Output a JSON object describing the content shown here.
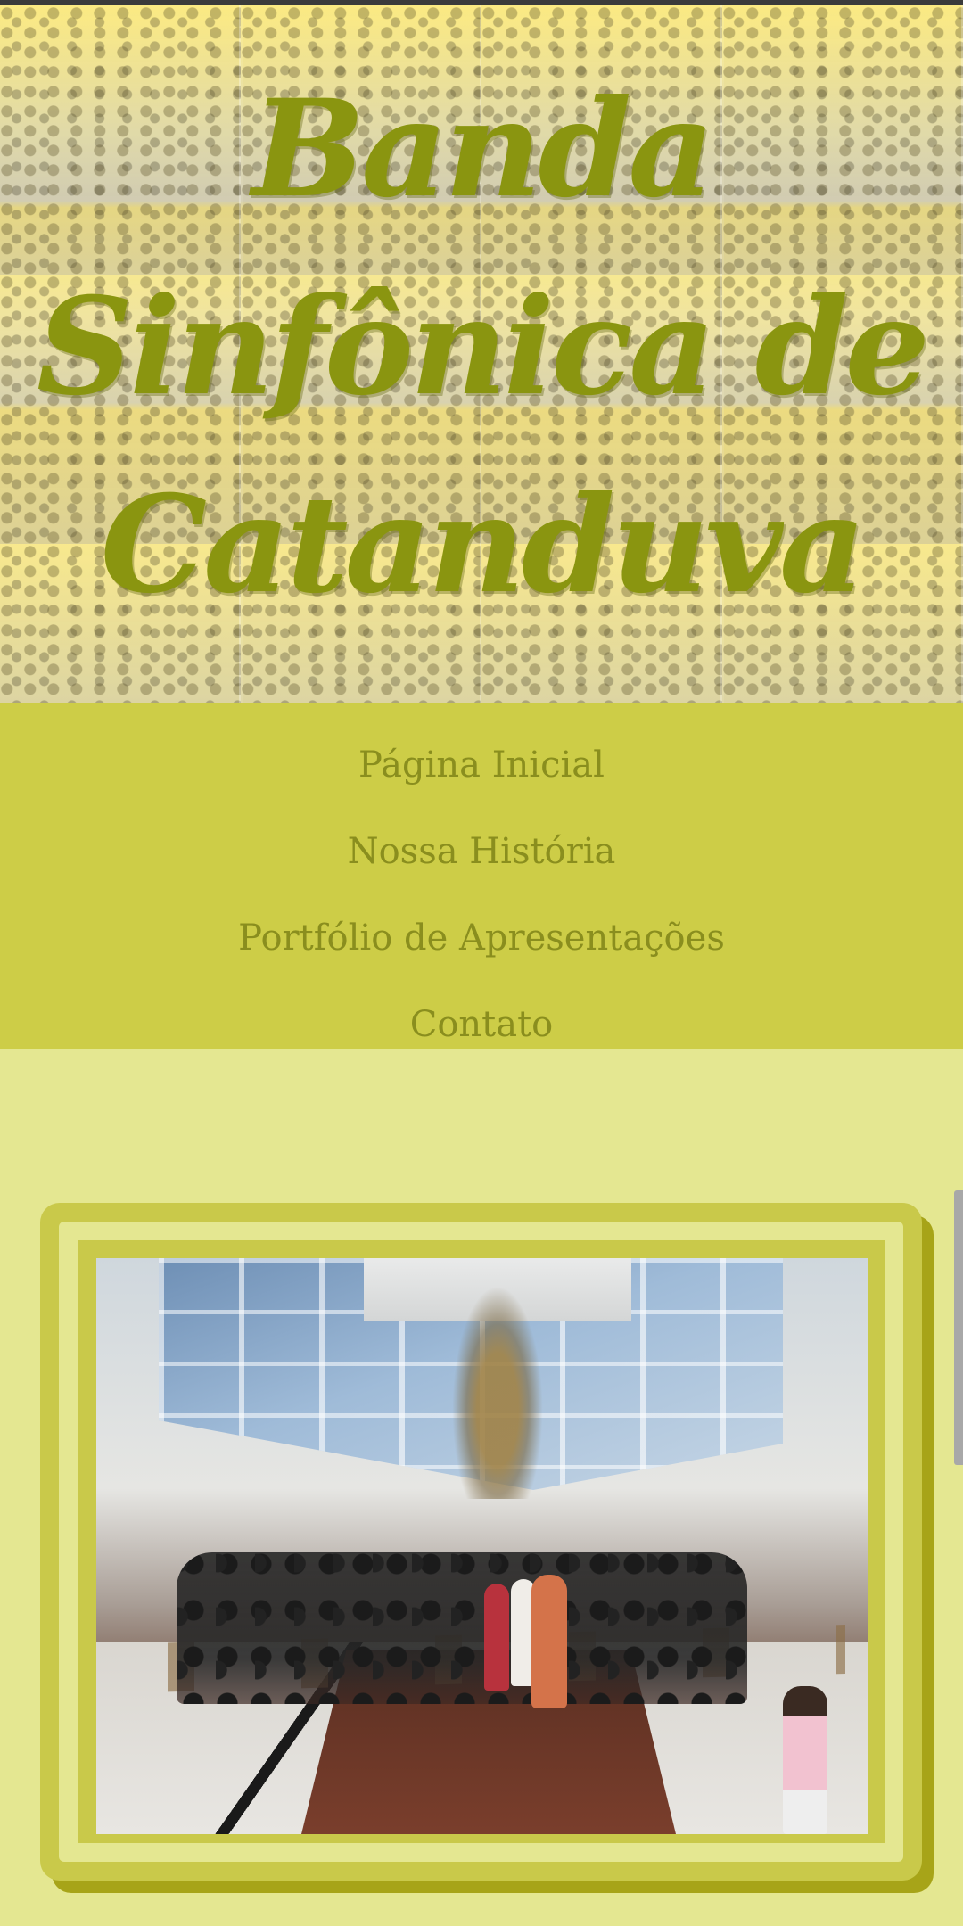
{
  "header": {
    "title_lines": [
      "Banda",
      "Sinfônica de",
      "Catanduva"
    ]
  },
  "nav": {
    "items": [
      {
        "label": "Página Inicial"
      },
      {
        "label": "Nossa História"
      },
      {
        "label": "Portfólio de Apresentações"
      },
      {
        "label": "Contato"
      }
    ]
  },
  "main": {
    "photo": {
      "description_icon": "band-group-photo-icon"
    }
  },
  "colors": {
    "title": "#8a9510",
    "nav_background": "#cdcd47",
    "nav_text": "#8a8e1e",
    "page_background": "#e4e791",
    "frame": "#c9c94a",
    "frame_shadow": "#a7a418"
  }
}
